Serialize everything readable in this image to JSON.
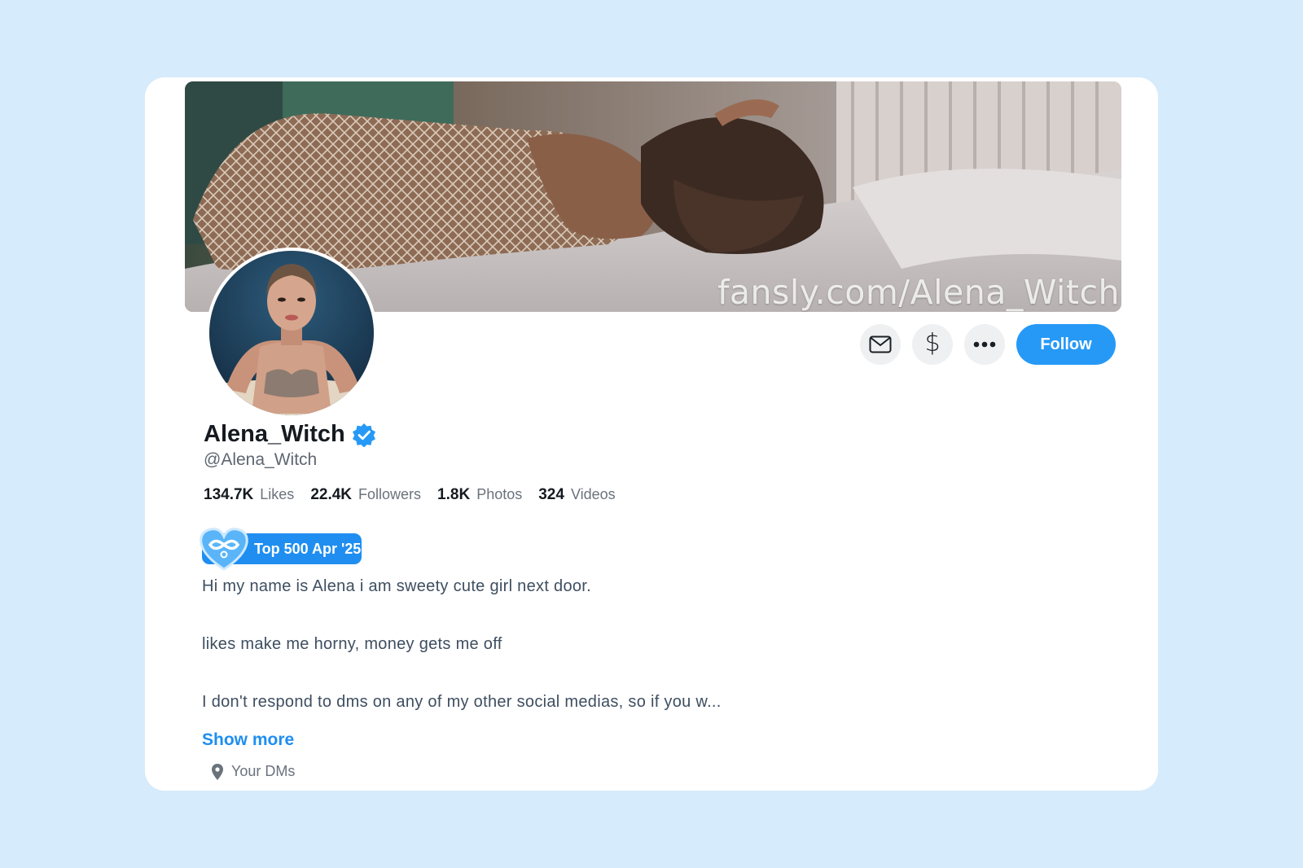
{
  "banner": {
    "watermark": "fansly.com/Alena_Witch"
  },
  "actions": {
    "message_icon": "envelope-icon",
    "tip_icon": "dollar-icon",
    "tip_glyph": "$",
    "more_icon": "more-dots-icon",
    "more_glyph": "•••",
    "follow_label": "Follow"
  },
  "profile": {
    "display_name": "Alena_Witch",
    "verified": true,
    "handle": "@Alena_Witch"
  },
  "stats": [
    {
      "value": "134.7K",
      "label": "Likes"
    },
    {
      "value": "22.4K",
      "label": "Followers"
    },
    {
      "value": "1.8K",
      "label": "Photos"
    },
    {
      "value": "324",
      "label": "Videos"
    }
  ],
  "badge": {
    "label": "Top 500 Apr '25",
    "icon": "heart-infinity-icon"
  },
  "bio": {
    "lines": [
      "Hi my name is Alena i am sweety cute girl next door.",
      "likes make me horny, money gets me off",
      "I don't respond to dms on any of my other social medias, so if you w..."
    ],
    "show_more": "Show more"
  },
  "location": {
    "icon": "location-pin-icon",
    "text": "Your DMs"
  },
  "colors": {
    "page_bg": "#d6ebfc",
    "accent": "#2699f6",
    "badge_bg": "#1f8ef0",
    "text_primary": "#151a20",
    "text_secondary": "#6a727c"
  }
}
